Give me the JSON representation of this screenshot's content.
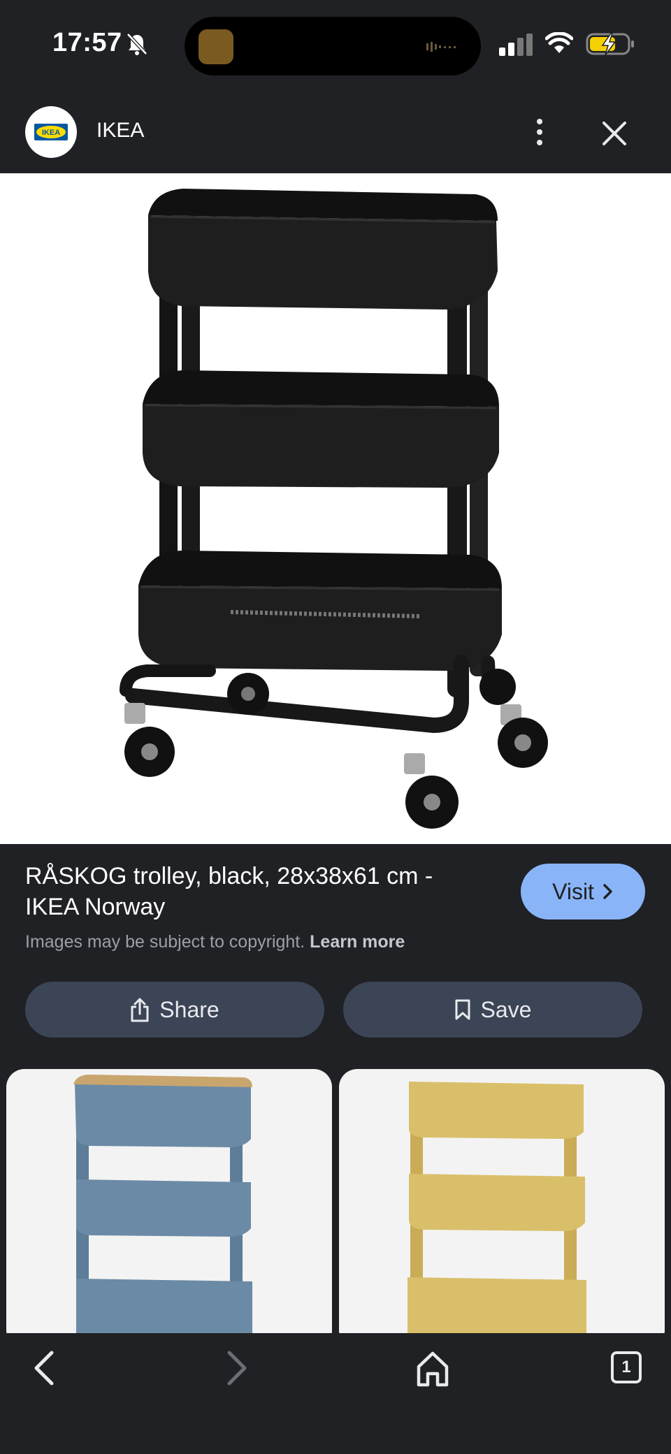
{
  "status_bar": {
    "time": "17:57"
  },
  "header": {
    "site_name": "IKEA",
    "logo_text": "IKEA"
  },
  "result": {
    "title": "RÅSKOG trolley, black, 28x38x61 cm - IKEA Norway",
    "copyright_text": "Images may be subject to copyright.",
    "learn_more": "Learn more",
    "visit_label": "Visit"
  },
  "actions": {
    "share_label": "Share",
    "save_label": "Save"
  },
  "related": [
    {
      "color": "#6b8aa6",
      "top_color": "#c9a56e"
    },
    {
      "color": "#d9bf6a",
      "top_color": "#d9bf6a"
    }
  ],
  "bottom_nav": {
    "tab_count": "1"
  },
  "colors": {
    "background": "#202124",
    "accent": "#8ab4f8",
    "button_bg": "#3c4556",
    "trolley": "#1c1c1c"
  }
}
